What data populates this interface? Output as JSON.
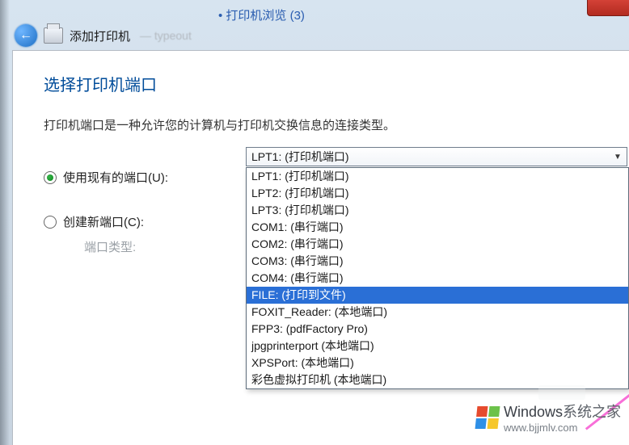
{
  "breadcrumb": {
    "text": "• 打印机浏览 (3)"
  },
  "titlebar": {
    "title": "添加打印机",
    "blur_suffix": "— typeout"
  },
  "wizard": {
    "heading": "选择打印机端口",
    "description": "打印机端口是一种允许您的计算机与打印机交换信息的连接类型。",
    "use_existing_label": "使用现有的端口(U):",
    "create_new_label": "创建新端口(C):",
    "port_type_label": "端口类型:"
  },
  "combo": {
    "selected_text": "LPT1: (打印机端口)"
  },
  "dropdown": {
    "options": [
      "LPT1: (打印机端口)",
      "LPT2: (打印机端口)",
      "LPT3: (打印机端口)",
      "COM1: (串行端口)",
      "COM2: (串行端口)",
      "COM3: (串行端口)",
      "COM4: (串行端口)",
      "FILE: (打印到文件)",
      "FOXIT_Reader: (本地端口)",
      "FPP3: (pdfFactory Pro)",
      "jpgprinterport (本地端口)",
      "XPSPort: (本地端口)",
      "彩色虚拟打印机 (本地端口)"
    ],
    "highlighted_index": 7
  },
  "watermark": {
    "brand_prefix": "Windows",
    "brand_suffix": "系统之家",
    "url": "www.bjjmlv.com"
  }
}
